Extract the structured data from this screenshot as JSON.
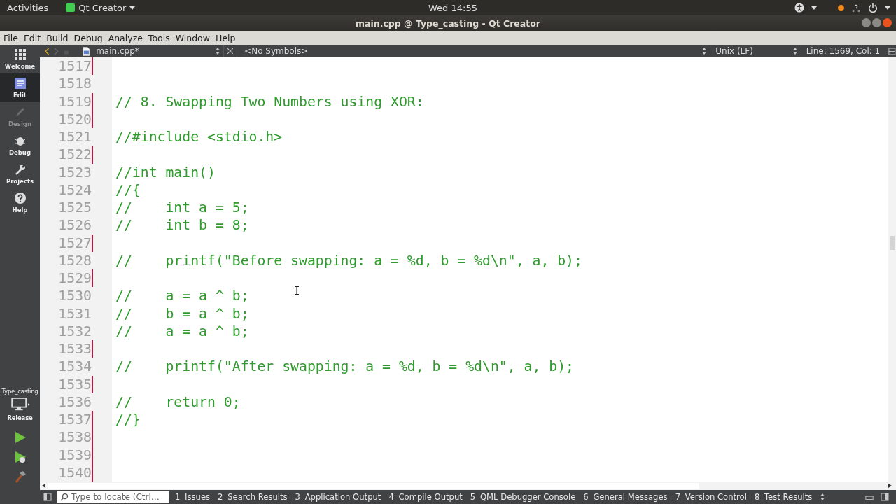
{
  "top_bar": {
    "activities": "Activities",
    "app_menu": "Qt Creator",
    "clock": "Wed 14:55"
  },
  "window": {
    "title": "main.cpp @ Type_casting - Qt Creator"
  },
  "menu": [
    "File",
    "Edit",
    "Build",
    "Debug",
    "Analyze",
    "Tools",
    "Window",
    "Help"
  ],
  "editor_toolbar": {
    "file": "main.cpp*",
    "symbols": "<No Symbols>",
    "line_ending": "Unix (LF)",
    "position": "Line: 1569, Col: 1"
  },
  "modes": [
    {
      "label": "Welcome",
      "selected": false,
      "disabled": false
    },
    {
      "label": "Edit",
      "selected": true,
      "disabled": false
    },
    {
      "label": "Design",
      "selected": false,
      "disabled": true
    },
    {
      "label": "Debug",
      "selected": false,
      "disabled": false
    },
    {
      "label": "Projects",
      "selected": false,
      "disabled": false
    },
    {
      "label": "Help",
      "selected": false,
      "disabled": false
    }
  ],
  "target": {
    "project": "Type_casting",
    "config": "Release"
  },
  "lines": [
    {
      "number": "1517",
      "changed": true
    },
    {
      "number": "1518",
      "changed": false
    },
    {
      "number": "1519",
      "text": "// 8. Swapping Two Numbers using XOR:",
      "changed": true
    },
    {
      "number": "1520",
      "changed": true
    },
    {
      "number": "1521",
      "text": "//#include <stdio.h>",
      "changed": false
    },
    {
      "number": "1522",
      "changed": true
    },
    {
      "number": "1523",
      "text": "//int main()",
      "changed": false
    },
    {
      "number": "1524",
      "text": "//{",
      "changed": false
    },
    {
      "number": "1525",
      "text": "//    int a = 5;",
      "changed": false
    },
    {
      "number": "1526",
      "text": "//    int b = 8;",
      "changed": false
    },
    {
      "number": "1527",
      "changed": true
    },
    {
      "number": "1528",
      "text": "//    printf(\"Before swapping: a = %d, b = %d\\n\", a, b);",
      "changed": false
    },
    {
      "number": "1529",
      "changed": true
    },
    {
      "number": "1530",
      "text": "//    a = a ^ b;",
      "changed": false
    },
    {
      "number": "1531",
      "text": "//    b = a ^ b;",
      "changed": false
    },
    {
      "number": "1532",
      "text": "//    a = a ^ b;",
      "changed": false
    },
    {
      "number": "1533",
      "changed": true
    },
    {
      "number": "1534",
      "text": "//    printf(\"After swapping: a = %d, b = %d\\n\", a, b);",
      "changed": false
    },
    {
      "number": "1535",
      "changed": true
    },
    {
      "number": "1536",
      "text": "//    return 0;",
      "changed": false
    },
    {
      "number": "1537",
      "text": "//}",
      "changed": true
    },
    {
      "number": "1538",
      "changed": true
    },
    {
      "number": "1539",
      "changed": true
    },
    {
      "number": "1540",
      "changed": true
    }
  ],
  "output_bar": {
    "search": {
      "placeholder": "Type to locate (Ctrl…"
    },
    "panes": [
      {
        "number": "1",
        "label": "Issues"
      },
      {
        "number": "2",
        "label": "Search Results"
      },
      {
        "number": "3",
        "label": "Application Output"
      },
      {
        "number": "4",
        "label": "Compile Output"
      },
      {
        "number": "5",
        "label": "QML Debugger Console"
      },
      {
        "number": "6",
        "label": "General Messages"
      },
      {
        "number": "7",
        "label": "Version Control"
      },
      {
        "number": "8",
        "label": "Test Results"
      }
    ]
  }
}
